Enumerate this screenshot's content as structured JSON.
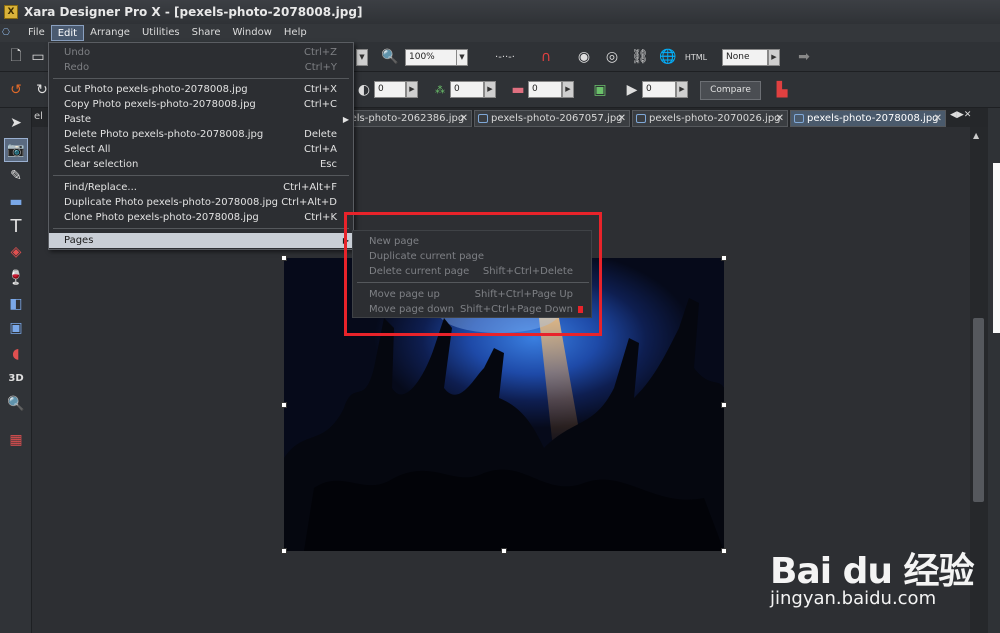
{
  "window": {
    "title": "Xara Designer Pro X - [pexels-photo-2078008.jpg]"
  },
  "menubar": [
    "File",
    "Edit",
    "Arrange",
    "Utilities",
    "Share",
    "Window",
    "Help"
  ],
  "toolbar": {
    "zoom_value": "100%",
    "none_value": "None",
    "html_label": "HTML",
    "field_values": [
      "0",
      "0",
      "0",
      "0"
    ],
    "compare_label": "Compare"
  },
  "tabs": [
    {
      "label": "xels-photo-2062386.jpg",
      "active": false
    },
    {
      "label": "pexels-photo-2067057.jpg",
      "active": false
    },
    {
      "label": "pexels-photo-2070026.jpg",
      "active": false
    },
    {
      "label": "pexels-photo-2078008.jpg",
      "active": true
    }
  ],
  "tab_prefix": "el",
  "edit_menu": [
    {
      "label": "Undo",
      "shortcut": "Ctrl+Z",
      "disabled": true
    },
    {
      "label": "Redo",
      "shortcut": "Ctrl+Y",
      "disabled": true
    },
    {
      "label": "Cut Photo pexels-photo-2078008.jpg",
      "shortcut": "Ctrl+X",
      "disabled": false
    },
    {
      "label": "Copy Photo pexels-photo-2078008.jpg",
      "shortcut": "Ctrl+C",
      "disabled": false
    },
    {
      "label": "Paste",
      "shortcut": "",
      "disabled": false,
      "submenu": true
    },
    {
      "label": "Delete Photo pexels-photo-2078008.jpg",
      "shortcut": "Delete",
      "disabled": false
    },
    {
      "label": "Select All",
      "shortcut": "Ctrl+A",
      "disabled": false
    },
    {
      "label": "Clear selection",
      "shortcut": "Esc",
      "disabled": false
    },
    {
      "label": "Find/Replace...",
      "shortcut": "Ctrl+Alt+F",
      "disabled": false
    },
    {
      "label": "Duplicate Photo pexels-photo-2078008.jpg",
      "shortcut": "Ctrl+Alt+D",
      "disabled": false
    },
    {
      "label": "Clone Photo pexels-photo-2078008.jpg",
      "shortcut": "Ctrl+K",
      "disabled": false
    },
    {
      "label": "Pages",
      "shortcut": "",
      "disabled": false,
      "highlighted": true,
      "submenu": true
    }
  ],
  "pages_submenu": [
    {
      "label": "New page",
      "shortcut": ""
    },
    {
      "label": "Duplicate current page",
      "shortcut": ""
    },
    {
      "label": "Delete current page",
      "shortcut": "Shift+Ctrl+Delete"
    },
    {
      "label": "Move page up",
      "shortcut": "Shift+Ctrl+Page Up"
    },
    {
      "label": "Move page down",
      "shortcut": "Shift+Ctrl+Page Down"
    }
  ],
  "watermark": {
    "brand": "Bai du 经验",
    "url": "jingyan.baidu.com"
  },
  "colors": {
    "highlight_box": "#e8232a",
    "menu_bg": "#2c2e32",
    "selected_item": "#c9ced6"
  }
}
